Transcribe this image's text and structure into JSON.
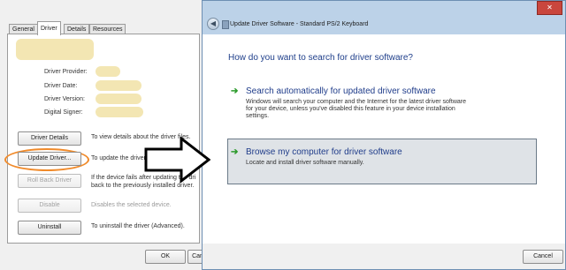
{
  "properties": {
    "tabs": [
      "General",
      "Driver",
      "Details",
      "Resources"
    ],
    "active_tab": "Driver",
    "info_labels": [
      "Driver Provider:",
      "Driver Date:",
      "Driver Version:",
      "Digital Signer:"
    ],
    "buttons": [
      {
        "label": "Driver Details",
        "desc": "To view details about the driver files.",
        "enabled": true
      },
      {
        "label": "Update Driver...",
        "desc": "To update the driver software for this device.",
        "enabled": true
      },
      {
        "label": "Roll Back Driver",
        "desc": "If the device fails after updating the driver, roll back to the previously installed driver.",
        "enabled": false
      },
      {
        "label": "Disable",
        "desc": "Disables the selected device.",
        "enabled": false
      },
      {
        "label": "Uninstall",
        "desc": "To uninstall the driver (Advanced).",
        "enabled": true
      }
    ],
    "desc_lines": {
      "driver_details": "To view details about the driver files.",
      "update_driver": "To update the driver software for this de",
      "roll_back_1": "If the device fails after updating the dri",
      "roll_back_2": "back to the previously installed driver.",
      "disable": "Disables the selected device.",
      "uninstall": "To uninstall the driver (Advanced)."
    },
    "footer": {
      "ok": "OK",
      "cancel": "Cancel"
    },
    "highlight_color": "#f08a2a"
  },
  "wizard": {
    "title": "Update Driver Software - Standard PS/2 Keyboard",
    "question": "How do you want to search for driver software?",
    "option_auto": {
      "title": "Search automatically for updated driver software",
      "desc_lines": [
        "Windows will search your computer and the Internet for the latest driver software",
        "for your device, unless you've disabled this feature in your device installation",
        "settings."
      ]
    },
    "option_browse": {
      "title": "Browse my computer for driver software",
      "desc": "Locate and install driver software manually."
    },
    "cancel": "Cancel",
    "close_glyph": "✕",
    "arrow_glyph": "➔",
    "back_glyph": "◀",
    "accent_color": "#1f3c8a"
  }
}
